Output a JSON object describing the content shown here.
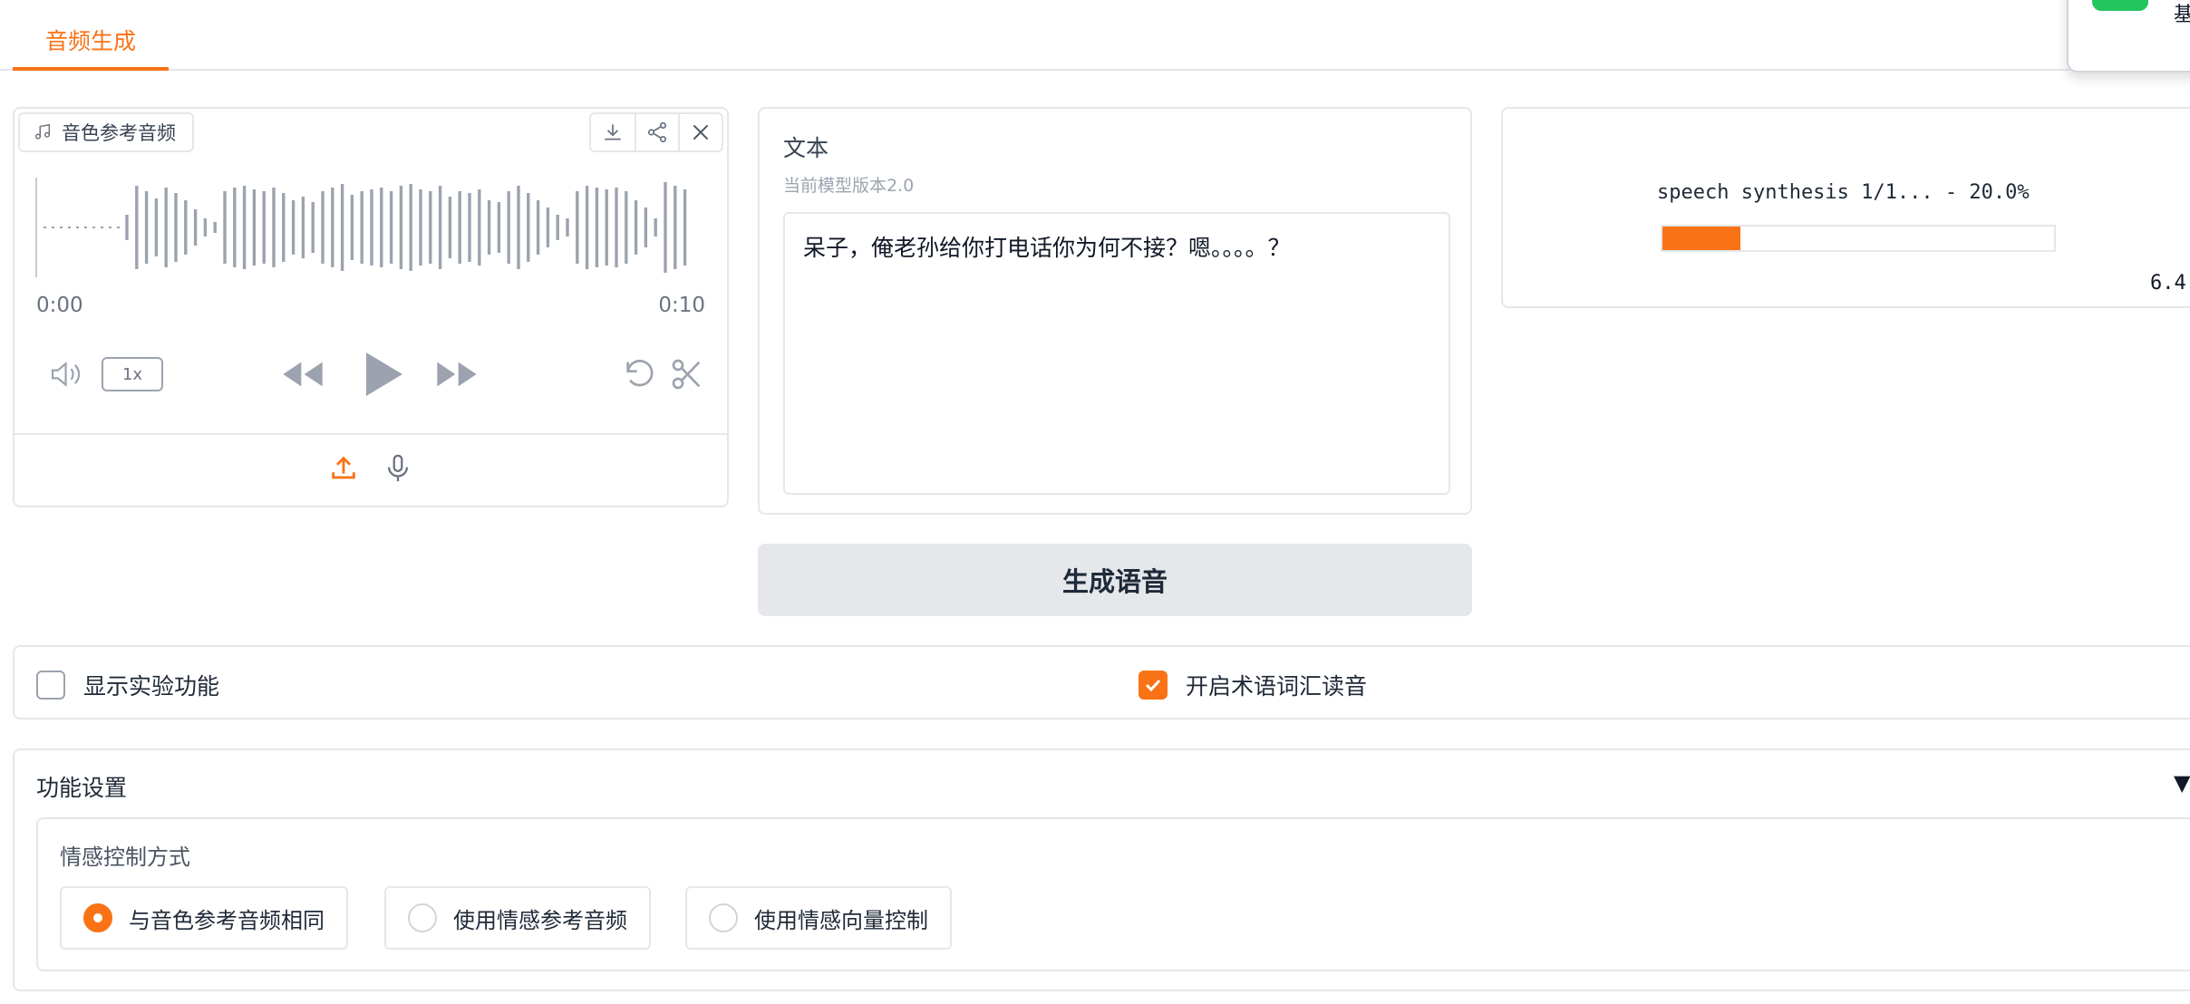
{
  "tabs": [
    {
      "label": "音频生成"
    }
  ],
  "audio": {
    "label": "音色参考音频",
    "time_start": "0:00",
    "time_end": "0:10",
    "speed": "1x"
  },
  "text": {
    "title": "文本",
    "info": "当前模型版本2.0",
    "value": "呆子，俺老孙给你打电话你为何不接？嗯。。。。？"
  },
  "generate": {
    "label": "生成语音"
  },
  "output": {
    "progress_text": "speech synthesis 1/1... - 20.0%",
    "progress": 0.2,
    "timer": "6.4"
  },
  "options": {
    "experimental": {
      "label": "显示实验功能",
      "checked": false
    },
    "terms": {
      "label": "开启术语词汇读音",
      "checked": true
    }
  },
  "settings": {
    "title": "功能设置",
    "caret": "▼",
    "emotion": {
      "title": "情感控制方式",
      "options": [
        {
          "label": "与音色参考音频相同",
          "selected": true
        },
        {
          "label": "使用情感参考音频",
          "selected": false
        },
        {
          "label": "使用情感向量控制",
          "selected": false
        }
      ]
    }
  },
  "popup": {
    "text": "基"
  },
  "colors": {
    "accent": "#f97316",
    "success": "#22c55e"
  }
}
